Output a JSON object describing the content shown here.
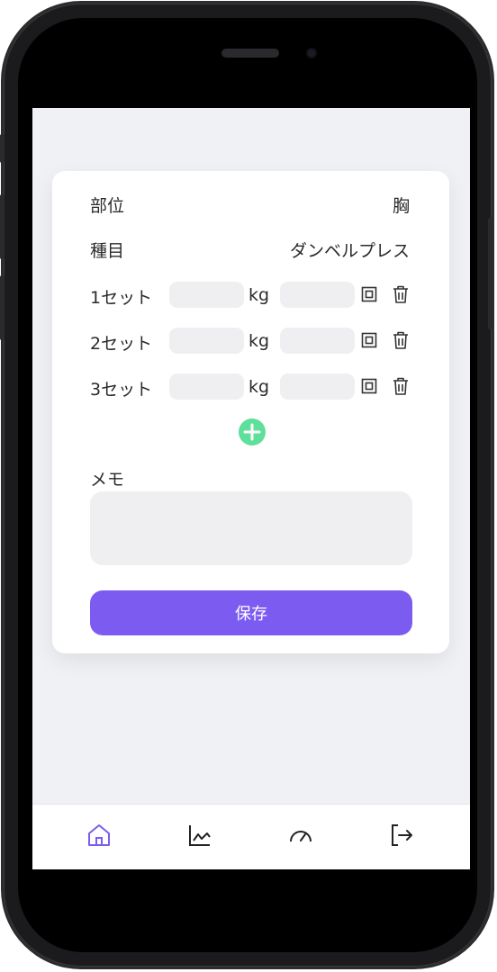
{
  "form": {
    "bodypart_label": "部位",
    "bodypart_value": "胸",
    "exercise_label": "種目",
    "exercise_value": "ダンベルプレス",
    "sets": [
      {
        "label": "1セット",
        "weight": "",
        "reps": "",
        "unit": "kg"
      },
      {
        "label": "2セット",
        "weight": "",
        "reps": "",
        "unit": "kg"
      },
      {
        "label": "3セット",
        "weight": "",
        "reps": "",
        "unit": "kg"
      }
    ],
    "memo_label": "メモ",
    "memo_value": "",
    "save_label": "保存"
  },
  "colors": {
    "accent": "#7c5cf0",
    "add_button": "#5fe09a",
    "field_bg": "#efeff2"
  },
  "tabs": [
    {
      "name": "home-icon",
      "active": true
    },
    {
      "name": "chart-icon",
      "active": false
    },
    {
      "name": "gauge-icon",
      "active": false
    },
    {
      "name": "logout-icon",
      "active": false
    }
  ]
}
